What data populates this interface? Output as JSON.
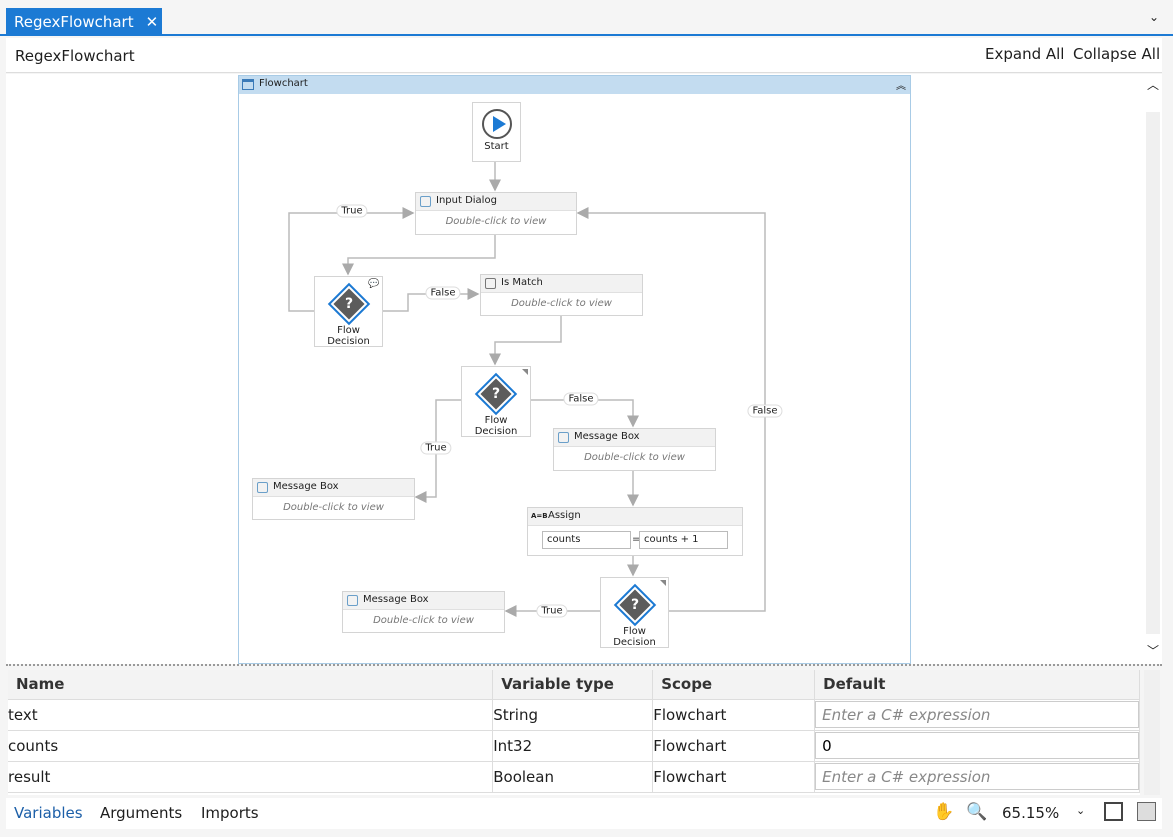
{
  "tab": {
    "title": "RegexFlowchart"
  },
  "header": {
    "title": "RegexFlowchart",
    "expand_all": "Expand All",
    "collapse_all": "Collapse All"
  },
  "flowchart": {
    "title": "Flowchart",
    "start": "Start",
    "input_dialog": {
      "title": "Input Dialog",
      "hint": "Double-click to view"
    },
    "is_match": {
      "title": "Is Match",
      "hint": "Double-click to view"
    },
    "decision1": "Flow Decision",
    "decision2": "Flow Decision",
    "decision3": "Flow Decision",
    "msg_right": {
      "title": "Message Box",
      "hint": "Double-click to view"
    },
    "msg_left": {
      "title": "Message Box",
      "hint": "Double-click to view"
    },
    "msg_bottom": {
      "title": "Message Box",
      "hint": "Double-click to view"
    },
    "assign": {
      "title": "Assign",
      "to": "counts",
      "eq": "=",
      "value": "counts + 1"
    },
    "edges": {
      "d1_true": "True",
      "d1_false": "False",
      "d2_true": "True",
      "d2_false": "False",
      "d3_true": "True",
      "d3_false": "False"
    }
  },
  "variables": {
    "columns": [
      "Name",
      "Variable type",
      "Scope",
      "Default"
    ],
    "placeholder": "Enter a C# expression",
    "rows": [
      {
        "name": "text",
        "type": "String",
        "scope": "Flowchart",
        "default": ""
      },
      {
        "name": "counts",
        "type": "Int32",
        "scope": "Flowchart",
        "default": "0"
      },
      {
        "name": "result",
        "type": "Boolean",
        "scope": "Flowchart",
        "default": ""
      }
    ]
  },
  "bottom": {
    "tabs": [
      "Variables",
      "Arguments",
      "Imports"
    ],
    "zoom": "65.15%"
  },
  "colors": {
    "accent": "#1c7ad4"
  }
}
